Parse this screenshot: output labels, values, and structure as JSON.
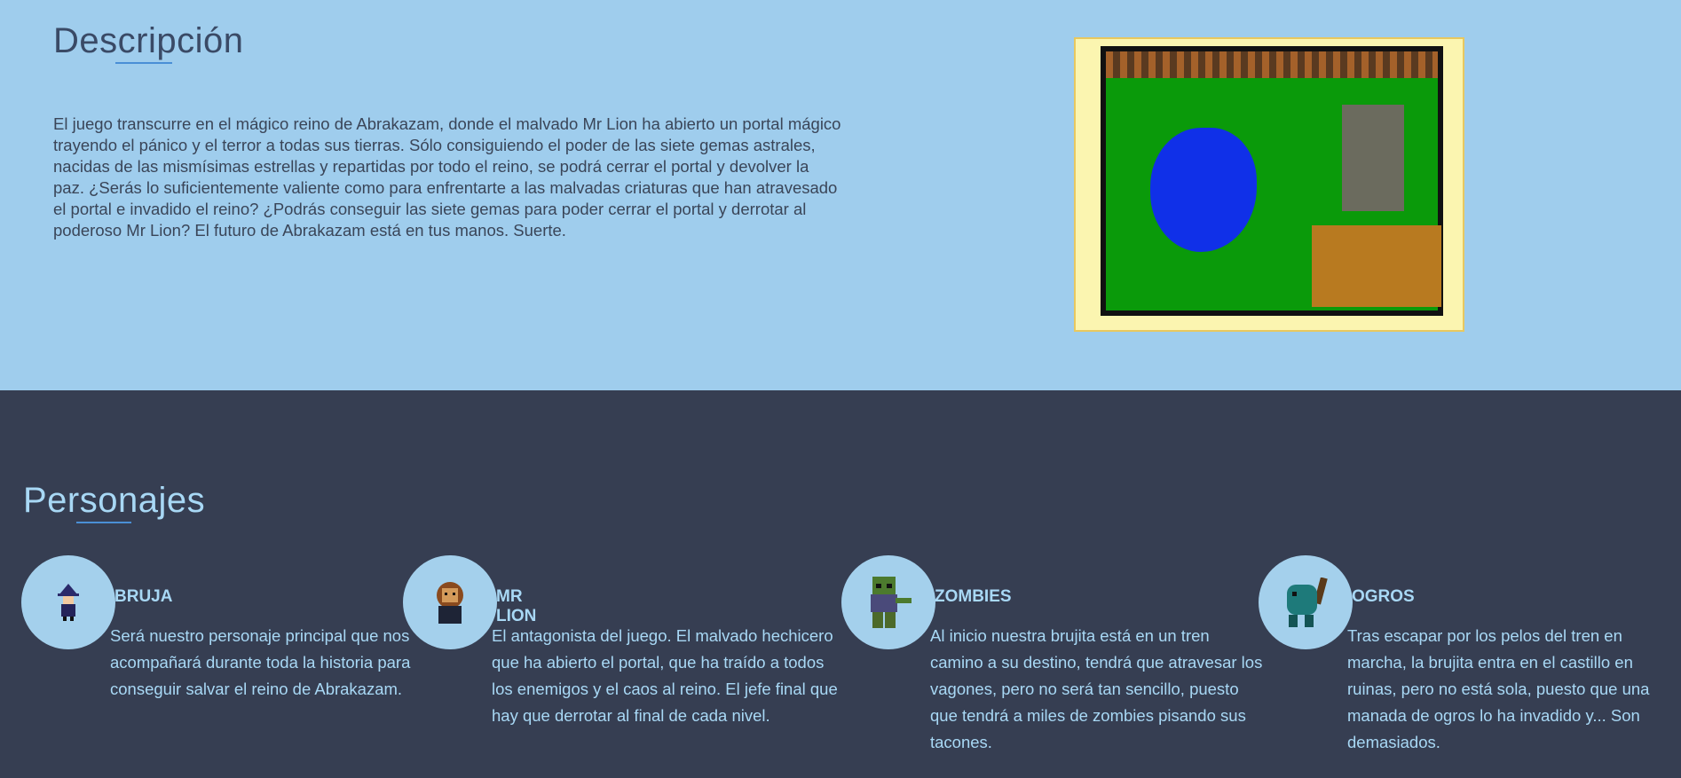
{
  "description": {
    "title": "Descripción",
    "text": "El juego transcurre en el mágico reino de Abrakazam, donde el malvado Mr Lion ha abierto un portal mágico trayendo el pánico y el terror a todas sus tierras. Sólo consiguiendo el poder de las siete gemas astrales, nacidas de las mismísimas estrellas y repartidas por todo el reino, se podrá cerrar el portal y devolver la paz. ¿Serás lo suficientemente valiente como para enfrentarte a las malvadas criaturas que han atravesado el portal e invadido el reino? ¿Podrás conseguir las siete gemas para poder cerrar el portal y derrotar al poderoso Mr Lion? El futuro de Abrakazam está en tus manos. Suerte."
  },
  "characters": {
    "title": "Personajes",
    "items": [
      {
        "name": "BRUJA",
        "text": "Será nuestro personaje principal que nos acompañará durante toda la historia para conseguir salvar el reino de Abrakazam."
      },
      {
        "name": "MR LION",
        "text": "El antagonista del juego. El malvado hechicero que ha abierto el portal, que ha traído a todos los enemigos y el caos al reino. El jefe final que hay que derrotar al final de cada nivel."
      },
      {
        "name": "ZOMBIES",
        "text": "Al inicio nuestra brujita está en un tren camino a su destino, tendrá que atravesar los vagones, pero no será tan sencillo, puesto que tendrá a miles de zombies pisando sus tacones."
      },
      {
        "name": "OGROS",
        "text": "Tras escapar por los pelos del tren en marcha, la brujita entra en el castillo en ruinas, pero no está sola, puesto que una manada de ogros lo ha invadido y... Son demasiados."
      }
    ]
  },
  "colors": {
    "top_background": "#9fcded",
    "bottom_background": "#363e52",
    "heading_light": "#a8d8f5",
    "accent_underline": "#4a8fd6"
  }
}
